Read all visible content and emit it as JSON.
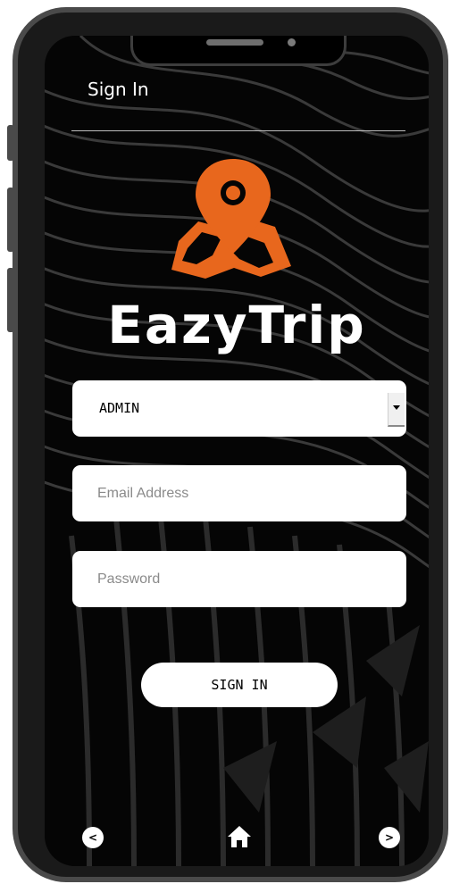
{
  "header": {
    "title": "Sign In"
  },
  "brand": {
    "name": "EazyTrip",
    "accent_color": "#e8671d"
  },
  "form": {
    "role_select": {
      "value": "ADMIN",
      "options": [
        "ADMIN"
      ]
    },
    "email": {
      "placeholder": "Email Address",
      "value": ""
    },
    "password": {
      "placeholder": "Password",
      "value": ""
    },
    "submit_label": "SIGN IN"
  },
  "bottom_nav": {
    "prev_icon": "chevron-left-icon",
    "prev_glyph": "<",
    "home_icon": "home-icon",
    "next_icon": "chevron-right-icon",
    "next_glyph": ">"
  }
}
